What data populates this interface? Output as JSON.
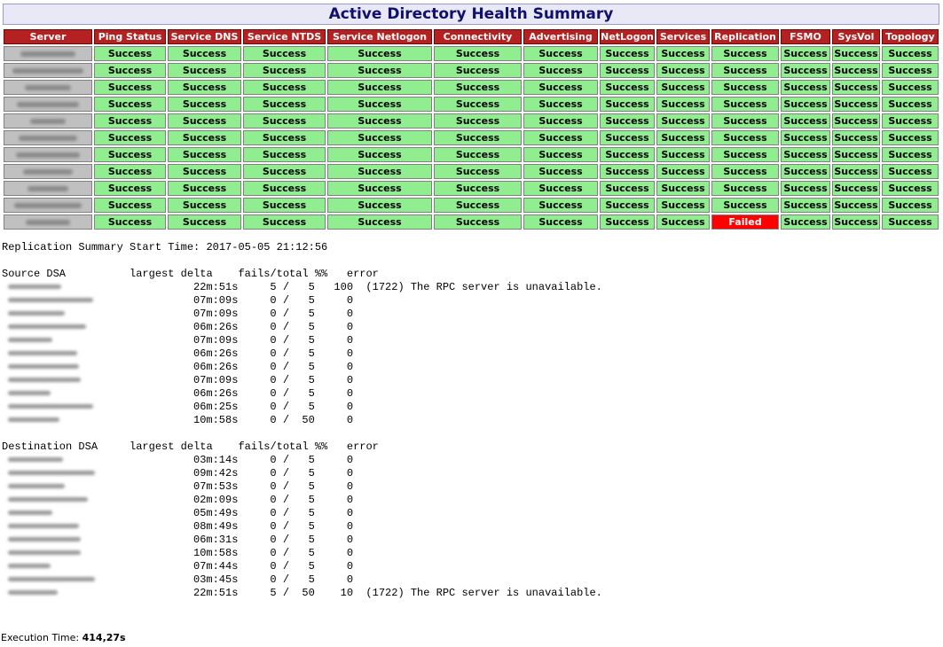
{
  "title": "Active Directory Health Summary",
  "columns": [
    "Server",
    "Ping Status",
    "Service DNS",
    "Service NTDS",
    "Service Netlogon",
    "Connectivity",
    "Advertising",
    "NetLogon",
    "Services",
    "Replication",
    "FSMO",
    "SysVol",
    "Topology"
  ],
  "status_colors": {
    "success": "#90ee90",
    "failed": "#ff0000",
    "header": "#b52020"
  },
  "rows": [
    [
      "Success",
      "Success",
      "Success",
      "Success",
      "Success",
      "Success",
      "Success",
      "Success",
      "Success",
      "Success",
      "Success",
      "Success"
    ],
    [
      "Success",
      "Success",
      "Success",
      "Success",
      "Success",
      "Success",
      "Success",
      "Success",
      "Success",
      "Success",
      "Success",
      "Success"
    ],
    [
      "Success",
      "Success",
      "Success",
      "Success",
      "Success",
      "Success",
      "Success",
      "Success",
      "Success",
      "Success",
      "Success",
      "Success"
    ],
    [
      "Success",
      "Success",
      "Success",
      "Success",
      "Success",
      "Success",
      "Success",
      "Success",
      "Success",
      "Success",
      "Success",
      "Success"
    ],
    [
      "Success",
      "Success",
      "Success",
      "Success",
      "Success",
      "Success",
      "Success",
      "Success",
      "Success",
      "Success",
      "Success",
      "Success"
    ],
    [
      "Success",
      "Success",
      "Success",
      "Success",
      "Success",
      "Success",
      "Success",
      "Success",
      "Success",
      "Success",
      "Success",
      "Success"
    ],
    [
      "Success",
      "Success",
      "Success",
      "Success",
      "Success",
      "Success",
      "Success",
      "Success",
      "Success",
      "Success",
      "Success",
      "Success"
    ],
    [
      "Success",
      "Success",
      "Success",
      "Success",
      "Success",
      "Success",
      "Success",
      "Success",
      "Success",
      "Success",
      "Success",
      "Success"
    ],
    [
      "Success",
      "Success",
      "Success",
      "Success",
      "Success",
      "Success",
      "Success",
      "Success",
      "Success",
      "Success",
      "Success",
      "Success"
    ],
    [
      "Success",
      "Success",
      "Success",
      "Success",
      "Success",
      "Success",
      "Success",
      "Success",
      "Success",
      "Success",
      "Success",
      "Success"
    ],
    [
      "Success",
      "Success",
      "Success",
      "Success",
      "Success",
      "Success",
      "Success",
      "Success",
      "Failed",
      "Success",
      "Success",
      "Success"
    ]
  ],
  "replication_start": "Replication Summary Start Time: 2017-05-05 21:12:56",
  "source_header": "Source DSA          largest delta    fails/total %%   error",
  "source_rows": [
    {
      "delta": "22m:51s",
      "fails": "5",
      "total": "5",
      "pct": "100",
      "error": "(1722) The RPC server is unavailable."
    },
    {
      "delta": "07m:09s",
      "fails": "0",
      "total": "5",
      "pct": "0",
      "error": ""
    },
    {
      "delta": "07m:09s",
      "fails": "0",
      "total": "5",
      "pct": "0",
      "error": ""
    },
    {
      "delta": "06m:26s",
      "fails": "0",
      "total": "5",
      "pct": "0",
      "error": ""
    },
    {
      "delta": "07m:09s",
      "fails": "0",
      "total": "5",
      "pct": "0",
      "error": ""
    },
    {
      "delta": "06m:26s",
      "fails": "0",
      "total": "5",
      "pct": "0",
      "error": ""
    },
    {
      "delta": "06m:26s",
      "fails": "0",
      "total": "5",
      "pct": "0",
      "error": ""
    },
    {
      "delta": "07m:09s",
      "fails": "0",
      "total": "5",
      "pct": "0",
      "error": ""
    },
    {
      "delta": "06m:26s",
      "fails": "0",
      "total": "5",
      "pct": "0",
      "error": ""
    },
    {
      "delta": "06m:25s",
      "fails": "0",
      "total": "5",
      "pct": "0",
      "error": ""
    },
    {
      "delta": "10m:58s",
      "fails": "0",
      "total": "50",
      "pct": "0",
      "error": ""
    }
  ],
  "dest_header": "Destination DSA     largest delta    fails/total %%   error",
  "dest_rows": [
    {
      "delta": "03m:14s",
      "fails": "0",
      "total": "5",
      "pct": "0",
      "error": ""
    },
    {
      "delta": "09m:42s",
      "fails": "0",
      "total": "5",
      "pct": "0",
      "error": ""
    },
    {
      "delta": "07m:53s",
      "fails": "0",
      "total": "5",
      "pct": "0",
      "error": ""
    },
    {
      "delta": "02m:09s",
      "fails": "0",
      "total": "5",
      "pct": "0",
      "error": ""
    },
    {
      "delta": "05m:49s",
      "fails": "0",
      "total": "5",
      "pct": "0",
      "error": ""
    },
    {
      "delta": "08m:49s",
      "fails": "0",
      "total": "5",
      "pct": "0",
      "error": ""
    },
    {
      "delta": "06m:31s",
      "fails": "0",
      "total": "5",
      "pct": "0",
      "error": ""
    },
    {
      "delta": "10m:58s",
      "fails": "0",
      "total": "5",
      "pct": "0",
      "error": ""
    },
    {
      "delta": "07m:44s",
      "fails": "0",
      "total": "5",
      "pct": "0",
      "error": ""
    },
    {
      "delta": "03m:45s",
      "fails": "0",
      "total": "5",
      "pct": "0",
      "error": ""
    },
    {
      "delta": "22m:51s",
      "fails": "5",
      "total": "50",
      "pct": "10",
      "error": "(1722) The RPC server is unavailable."
    }
  ],
  "execution_label": "Execution Time:",
  "execution_value": "414,27s"
}
